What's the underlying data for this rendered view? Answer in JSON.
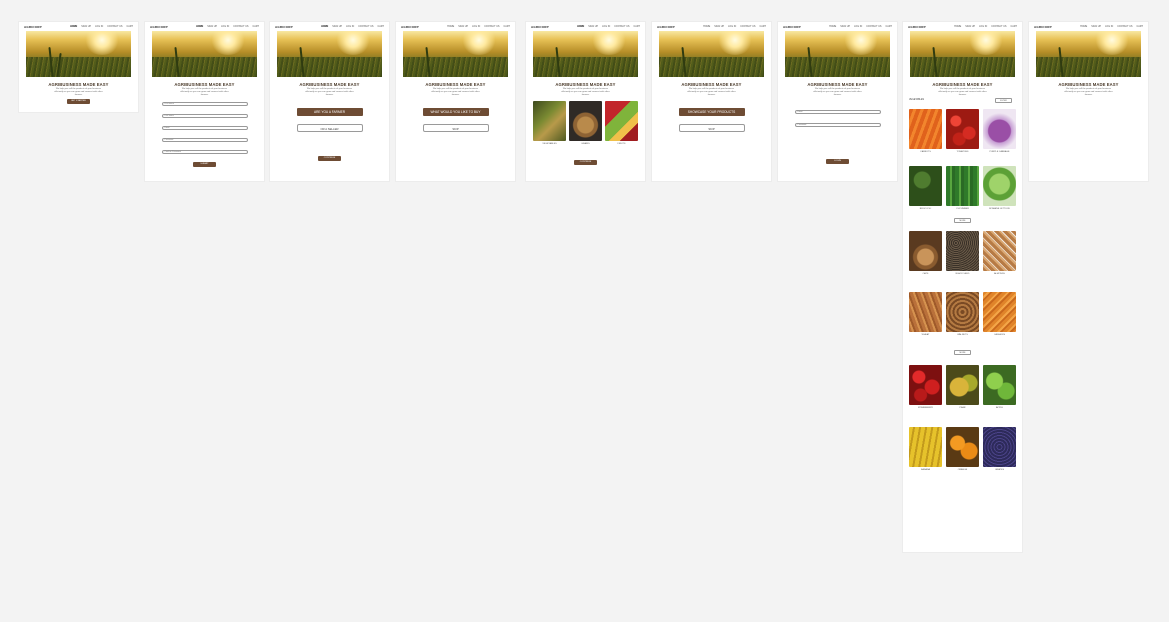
{
  "brand": "AGRICORP",
  "nav_links": [
    "HOME",
    "SIGN UP",
    "LOG IN",
    "CONTACT US",
    "CART"
  ],
  "hero_title": "AGRIBUSINESS MADE EASY",
  "hero_desc": "We help you sell the products of your business efficiently so you can grow and connect with other farmers",
  "screen1": {
    "cta": "GET STARTED"
  },
  "screen2": {
    "fields": [
      "First name",
      "Last name",
      "Email",
      "Password",
      "Confirm Password"
    ],
    "submit": "SUBMIT"
  },
  "screen3": {
    "option1": "ARE YOU A FARMER",
    "option2": "OR A SELLER",
    "next": "CONTINUE"
  },
  "screen4": {
    "question": "WHAT WOULD YOU LIKE TO BUY",
    "skip": "SKIP"
  },
  "screen5": {
    "categories": [
      "VEGETABLES",
      "GRAINS",
      "FRUITS"
    ],
    "next": "CONTINUE"
  },
  "screen6": {
    "primary": "SHOWCASE YOUR PRODUCTS",
    "skip": "SKIP"
  },
  "screen7": {
    "fields": [
      "Email",
      "Password"
    ],
    "login": "LOGIN"
  },
  "screen8": {
    "section_label": "VEGETABLES",
    "top_button": "FILTER",
    "vegetables": [
      "CARROTS",
      "TOMATOES",
      "PURPLE CABBAGE",
      "BROCCOLI",
      "CUCUMBER",
      "ROMAINE LETTUCE"
    ],
    "more1": "MORE",
    "grains": [
      "OATS",
      "BLACK SEED",
      "ALMONDS",
      "WHEAT",
      "WALNUTS",
      "CASHEWS"
    ],
    "more2": "MORE",
    "fruits": [
      "STRAWBERRY",
      "PEAR",
      "APPLE",
      "BANANA",
      "ORANGE",
      "GRAPES"
    ]
  },
  "colors": {
    "accent": "#6e4c34",
    "background": "#f3f3f3"
  }
}
